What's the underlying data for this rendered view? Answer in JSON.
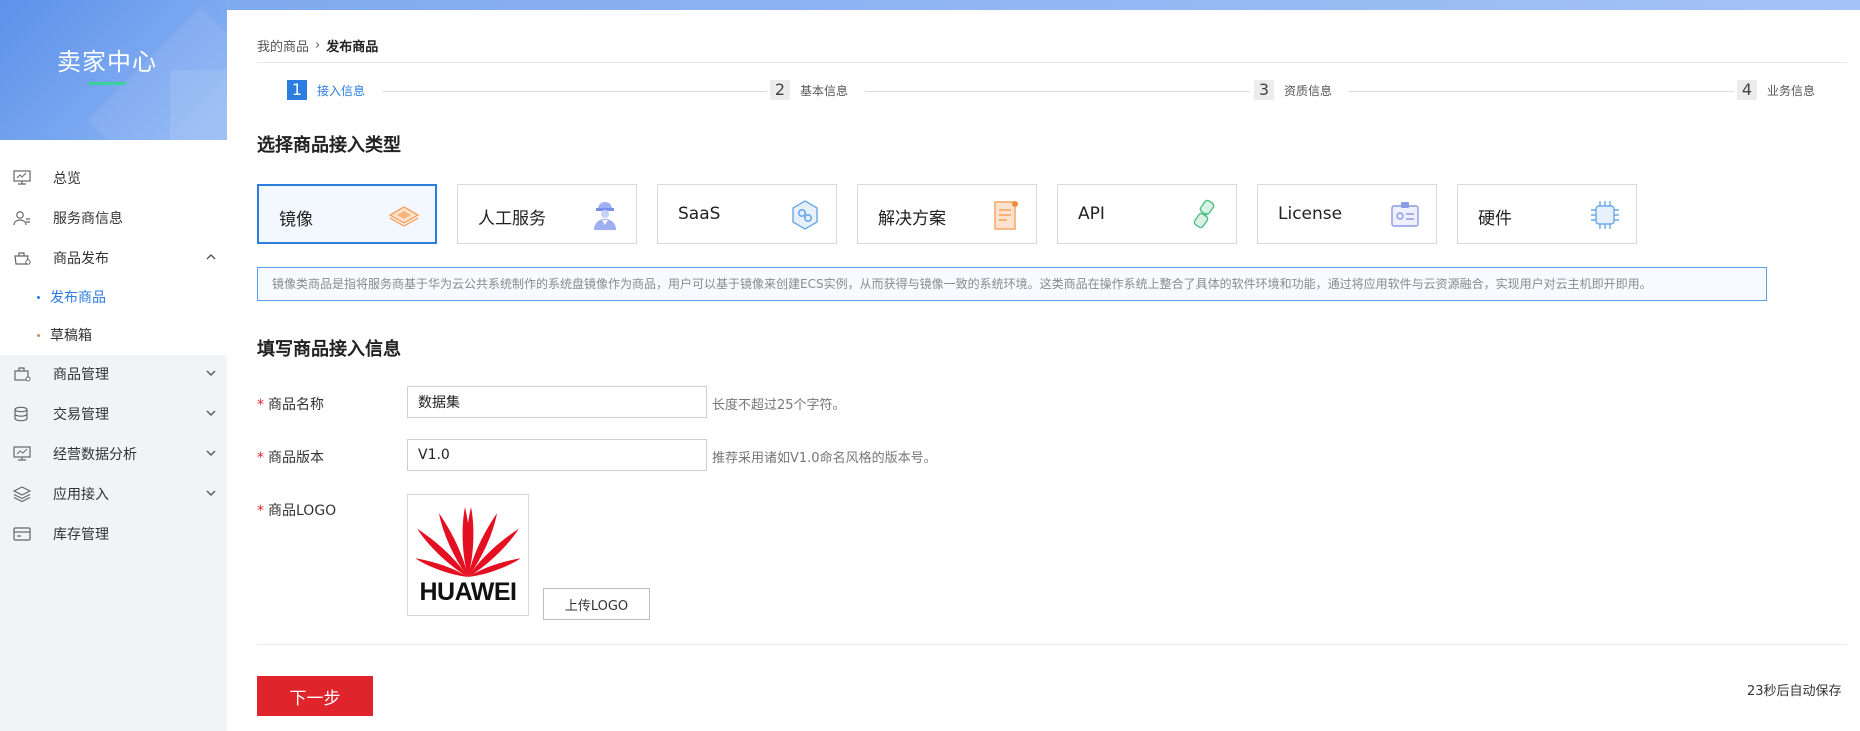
{
  "sidebar": {
    "title": "卖家中心",
    "items": [
      {
        "label": "总览",
        "icon": "monitor-icon"
      },
      {
        "label": "服务商信息",
        "icon": "user-icon"
      },
      {
        "label": "商品发布",
        "icon": "cart-icon",
        "expanded": true,
        "children": [
          {
            "label": "发布商品",
            "active": true
          },
          {
            "label": "草稿箱"
          }
        ]
      },
      {
        "label": "商品管理",
        "icon": "box-icon"
      },
      {
        "label": "交易管理",
        "icon": "database-icon"
      },
      {
        "label": "经营数据分析",
        "icon": "chart-icon"
      },
      {
        "label": "应用接入",
        "icon": "layers-icon"
      },
      {
        "label": "库存管理",
        "icon": "card-icon"
      }
    ]
  },
  "breadcrumb": {
    "parent": "我的商品",
    "separator": "›",
    "current": "发布商品"
  },
  "steps": [
    {
      "num": "1",
      "label": "接入信息",
      "active": true
    },
    {
      "num": "2",
      "label": "基本信息"
    },
    {
      "num": "3",
      "label": "资质信息"
    },
    {
      "num": "4",
      "label": "业务信息"
    }
  ],
  "section_type_title": "选择商品接入类型",
  "types": [
    {
      "label": "镜像",
      "icon": "image-stack-icon",
      "selected": true
    },
    {
      "label": "人工服务",
      "icon": "worker-icon"
    },
    {
      "label": "SaaS",
      "icon": "saas-hexagon-icon"
    },
    {
      "label": "解决方案",
      "icon": "document-icon"
    },
    {
      "label": "API",
      "icon": "api-plug-icon"
    },
    {
      "label": "License",
      "icon": "license-card-icon"
    },
    {
      "label": "硬件",
      "icon": "chip-icon"
    }
  ],
  "type_description": "镜像类商品是指将服务商基于华为云公共系统制作的系统盘镜像作为商品，用户可以基于镜像来创建ECS实例，从而获得与镜像一致的系统环境。这类商品在操作系统上整合了具体的软件环境和功能，通过将应用软件与云资源融合，实现用户对云主机即开即用。",
  "section_form_title": "填写商品接入信息",
  "form": {
    "required_mark": "*",
    "name": {
      "label": "商品名称",
      "value": "数据集",
      "hint": "长度不超过25个字符。"
    },
    "version": {
      "label": "商品版本",
      "value": "V1.0",
      "hint": "推荐采用诸如V1.0命名风格的版本号。"
    },
    "logo": {
      "label": "商品LOGO",
      "logo_text": "HUAWEI",
      "upload_label": "上传LOGO"
    }
  },
  "footer": {
    "next_label": "下一步",
    "autosave_text": "23秒后自动保存"
  },
  "colors": {
    "accent": "#2b7de0",
    "primary_button": "#e0242c",
    "huawei_red": "#e40f20",
    "sidebar_header": "#6b9cec"
  }
}
